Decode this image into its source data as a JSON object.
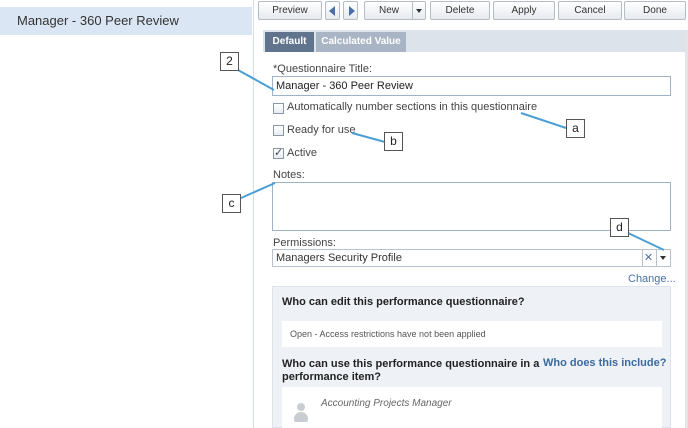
{
  "left_panel": {
    "selected_item": "Manager - 360 Peer Review"
  },
  "toolbar": {
    "preview": "Preview",
    "new": "New",
    "delete": "Delete",
    "apply": "Apply",
    "cancel": "Cancel",
    "done": "Done"
  },
  "tabs": {
    "default": "Default",
    "calculated_value": "Calculated Value"
  },
  "form": {
    "title_label": "*Questionnaire Title:",
    "title_value": "Manager - 360 Peer Review",
    "auto_number_label": "Automatically number sections in this questionnaire",
    "auto_number_checked": false,
    "ready_label": "Ready for use",
    "ready_checked": false,
    "active_label": "Active",
    "active_checked": true,
    "notes_label": "Notes:",
    "notes_value": "",
    "permissions_label": "Permissions:",
    "permissions_value": "Managers Security Profile",
    "change_link": "Change..."
  },
  "info": {
    "edit_heading": "Who can edit this performance questionnaire?",
    "edit_status": "Open - Access restrictions have not been applied",
    "use_heading_line1": "Who can use this performance questionnaire in a",
    "use_heading_line2": "performance item?",
    "include_link": "Who does this include?",
    "profile_name": "Accounting Projects Manager"
  },
  "callouts": {
    "c2": "2",
    "a": "a",
    "b": "b",
    "c": "c",
    "d": "d"
  },
  "colors": {
    "selected_bg": "#dbe6f4",
    "tab_active": "#60748e",
    "tab_inactive": "#a9b5c4",
    "link": "#3b6aa0"
  }
}
